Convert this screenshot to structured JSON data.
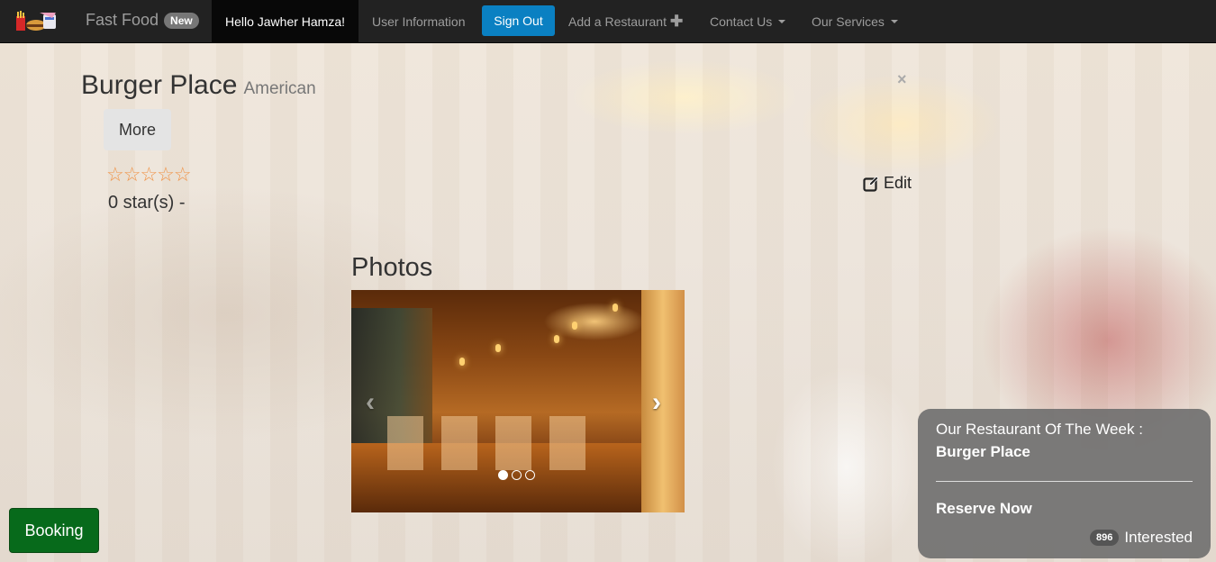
{
  "navbar": {
    "brand": "Fast Food",
    "brand_badge": "New",
    "greeting": "Hello Jawher Hamza!",
    "user_info": "User Information",
    "sign_out": "Sign Out",
    "add_restaurant": "Add a Restaurant",
    "contact_us": "Contact Us",
    "our_services": "Our Services"
  },
  "restaurant": {
    "name": "Burger Place",
    "cuisine": "American",
    "more_label": "More",
    "stars_display": "☆☆☆☆☆",
    "rating_text": "0 star(s) -",
    "edit_label": "Edit",
    "close_symbol": "×"
  },
  "photos": {
    "heading": "Photos",
    "slide_count": 3,
    "active_slide": 1
  },
  "booking": {
    "label": "Booking"
  },
  "week_panel": {
    "title": "Our Restaurant Of The Week :",
    "restaurant_name": "Burger Place",
    "reserve_label": "Reserve Now",
    "interested_count": "896",
    "interested_label": "Interested"
  },
  "colors": {
    "navbar_bg": "#222222",
    "sign_out_bg": "#0a80c2",
    "booking_bg": "#076a1b",
    "star_color": "#f0954a"
  }
}
